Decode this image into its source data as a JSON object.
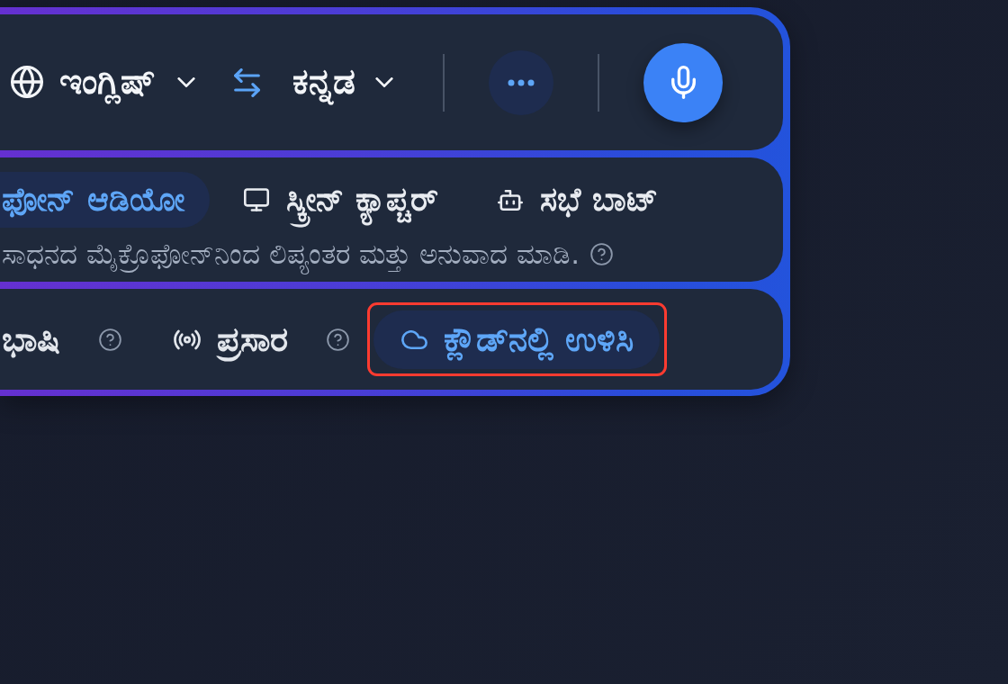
{
  "language_bar": {
    "source_language": "ಇಂಗ್ಲಿಷ್",
    "target_language": "ಕನ್ನಡ"
  },
  "input_modes": {
    "tabs": [
      {
        "label": "ಫೋನ್ ಆಡಿಯೋ",
        "selected": true
      },
      {
        "label": "ಸ್ಕ್ರೀನ್ ಕ್ಯಾಪ್ಚರ್",
        "kind": "screen",
        "selected": false
      },
      {
        "label": "ಸಭೆ ಬಾಟ್",
        "kind": "bot",
        "selected": false
      }
    ],
    "description": "ಸಾಧನದ ಮೈಕ್ರೊಫೋನ್‌ನಿಂದ ಲಿಪ್ಯಂತರ ಮತ್ತು ಅನುವಾದ ಮಾಡಿ."
  },
  "options": [
    {
      "label": "ಭಾಷಿ",
      "on": false,
      "help": true,
      "highlighted": false
    },
    {
      "label": "ಪ್ರಸಾರ",
      "kind": "broadcast",
      "on": false,
      "help": true,
      "highlighted": false
    },
    {
      "label": "ಕ್ಲೌಡ್‌ನಲ್ಲಿ ಉಳಿಸಿ",
      "kind": "cloud",
      "on": true,
      "help": false,
      "highlighted": true
    }
  ]
}
